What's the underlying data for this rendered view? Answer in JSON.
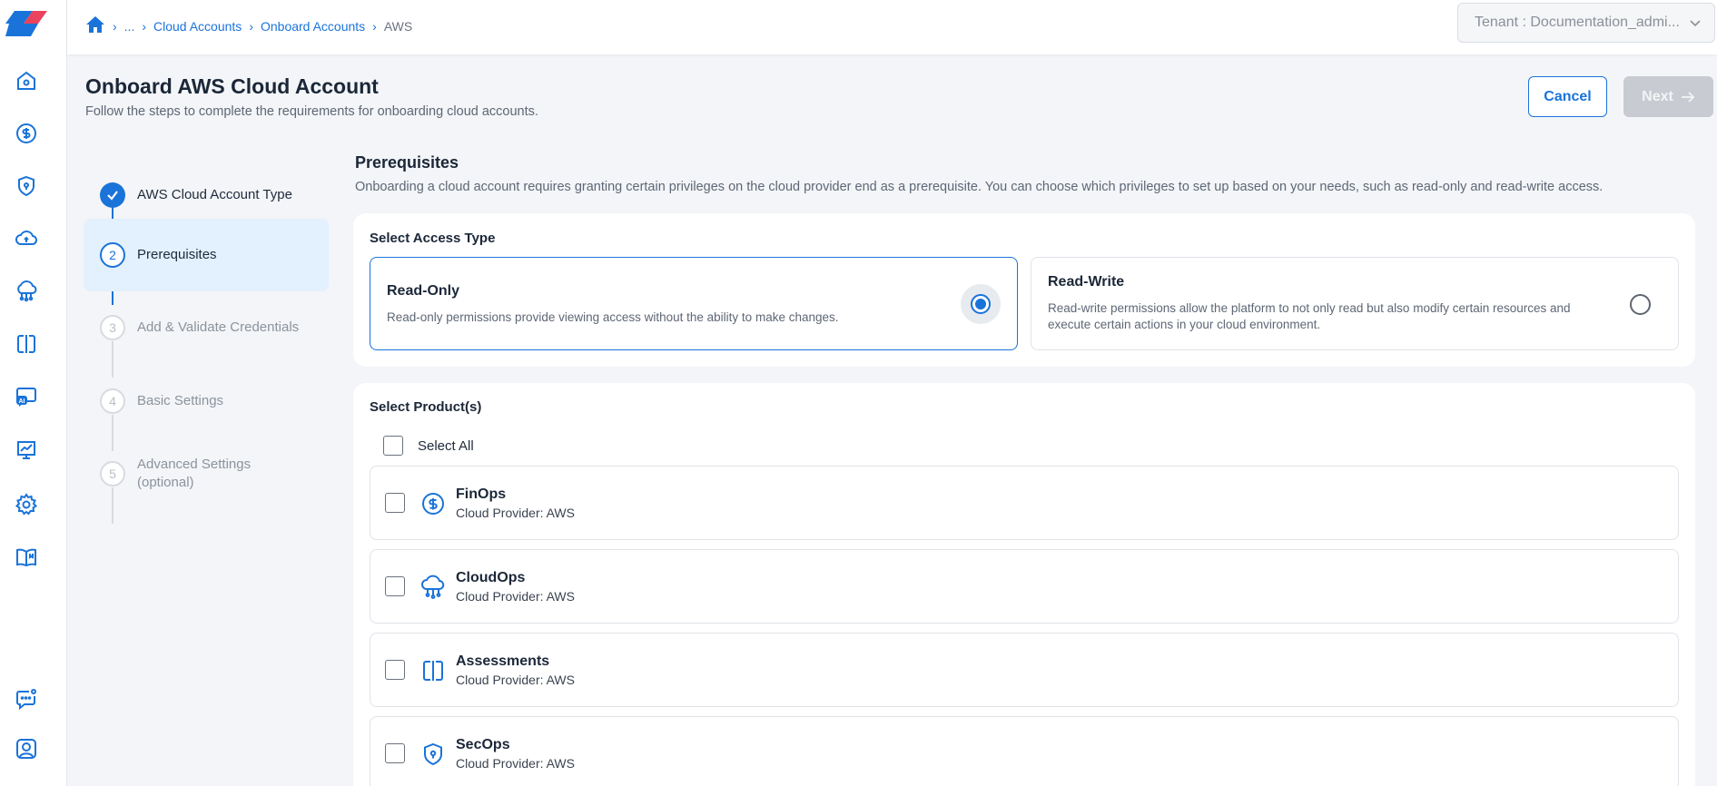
{
  "breadcrumb": {
    "ellipsis": "...",
    "items": [
      "Cloud Accounts",
      "Onboard Accounts"
    ],
    "current": "AWS"
  },
  "tenant": {
    "label": "Tenant : Documentation_admi..."
  },
  "header": {
    "title": "Onboard AWS Cloud Account",
    "subtitle": "Follow the steps to complete the requirements for onboarding cloud accounts.",
    "cancel_label": "Cancel",
    "next_label": "Next"
  },
  "steps": [
    {
      "number": "1",
      "label": "AWS Cloud Account Type",
      "state": "done"
    },
    {
      "number": "2",
      "label": "Prerequisites",
      "state": "current"
    },
    {
      "number": "3",
      "label": "Add & Validate Credentials",
      "state": "todo"
    },
    {
      "number": "4",
      "label": "Basic Settings",
      "state": "todo"
    },
    {
      "number": "5",
      "label": "Advanced Settings\n(optional)",
      "state": "todo"
    }
  ],
  "section": {
    "title": "Prerequisites",
    "description": "Onboarding a cloud account requires granting certain privileges on the cloud provider end as a prerequisite. You can choose which privileges to set up based on your needs, such as read-only and read-write access."
  },
  "access": {
    "label": "Select Access Type",
    "options": [
      {
        "title": "Read-Only",
        "description": "Read-only permissions provide viewing access without the ability to make changes.",
        "selected": true
      },
      {
        "title": "Read-Write",
        "description": "Read-write permissions allow the platform to not only read but also modify certain resources and execute certain actions in your cloud environment.",
        "selected": false
      }
    ]
  },
  "products": {
    "label": "Select Product(s)",
    "select_all": "Select All",
    "items": [
      {
        "name": "FinOps",
        "provider": "Cloud Provider: AWS",
        "icon": "dollar-circle-icon"
      },
      {
        "name": "CloudOps",
        "provider": "Cloud Provider: AWS",
        "icon": "cloud-network-icon"
      },
      {
        "name": "Assessments",
        "provider": "Cloud Provider: AWS",
        "icon": "assessment-icon"
      },
      {
        "name": "SecOps",
        "provider": "Cloud Provider: AWS",
        "icon": "shield-icon"
      }
    ]
  },
  "colors": {
    "accent": "#1a73d9",
    "active_step_bg": "#e3f0fd",
    "disabled_button": "#c8ccd2"
  }
}
